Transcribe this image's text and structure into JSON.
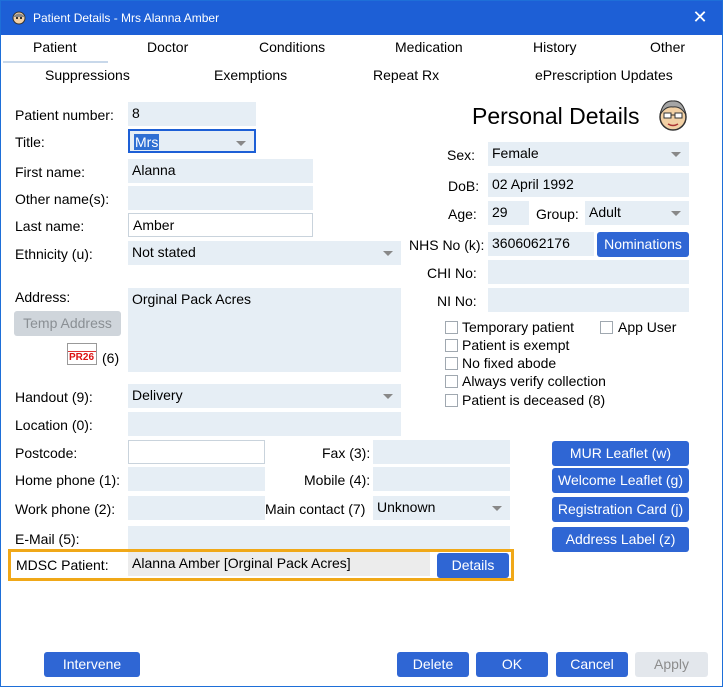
{
  "window": {
    "title": "Patient Details - Mrs Alanna Amber",
    "close_glyph": "✕"
  },
  "tabs_row1": [
    "Patient",
    "Doctor",
    "Conditions",
    "Medication",
    "History",
    "Other"
  ],
  "tabs_row2": [
    "Suppressions",
    "Exemptions",
    "Repeat Rx",
    "ePrescription Updates"
  ],
  "left": {
    "patient_number_label": "Patient number:",
    "patient_number": "8",
    "title_label": "Title:",
    "title_value": "Mrs",
    "first_name_label": "First name:",
    "first_name": "Alanna",
    "other_names_label": "Other name(s):",
    "other_names": "",
    "last_name_label": "Last name:",
    "last_name": "Amber",
    "ethnicity_label": "Ethnicity (u):",
    "ethnicity": "Not stated",
    "address_label": "Address:",
    "address": "Orginal Pack Acres",
    "temp_address_label": "Temp Address",
    "pr26_label": "PR26",
    "pr26_count": "(6)",
    "handout_label": "Handout (9):",
    "handout": "Delivery",
    "location_label": "Location (0):",
    "location": "",
    "postcode_label": "Postcode:",
    "postcode": "",
    "home_phone_label": "Home phone (1):",
    "home_phone": "",
    "work_phone_label": "Work phone (2):",
    "work_phone": "",
    "email_label": "E-Mail (5):",
    "email": "",
    "fax_label": "Fax (3):",
    "fax": "",
    "mobile_label": "Mobile (4):",
    "mobile": "",
    "main_contact_label": "Main contact (7)",
    "main_contact": "Unknown"
  },
  "right": {
    "heading": "Personal Details",
    "sex_label": "Sex:",
    "sex": "Female",
    "dob_label": "DoB:",
    "dob": "02 April 1992",
    "age_label": "Age:",
    "age": "29",
    "group_label": "Group:",
    "group": "Adult",
    "nhs_label": "NHS No (k):",
    "nhs": "3606062176",
    "nominations_label": "Nominations",
    "chi_label": "CHI No:",
    "chi": "",
    "ni_label": "NI No:",
    "ni": "",
    "checkboxes": [
      "Temporary patient",
      "Patient is exempt",
      "No fixed abode",
      "Always verify collection",
      "Patient is deceased (8)"
    ],
    "app_user_label": "App User"
  },
  "actions": [
    "MUR Leaflet (w)",
    "Welcome Leaflet (g)",
    "Registration Card (j)",
    "Address Label (z)"
  ],
  "mdsc": {
    "label": "MDSC Patient:",
    "value": "Alanna Amber [Orginal Pack Acres]",
    "details_label": "Details"
  },
  "footer": {
    "intervene": "Intervene",
    "delete": "Delete",
    "ok": "OK",
    "cancel": "Cancel",
    "apply": "Apply"
  }
}
